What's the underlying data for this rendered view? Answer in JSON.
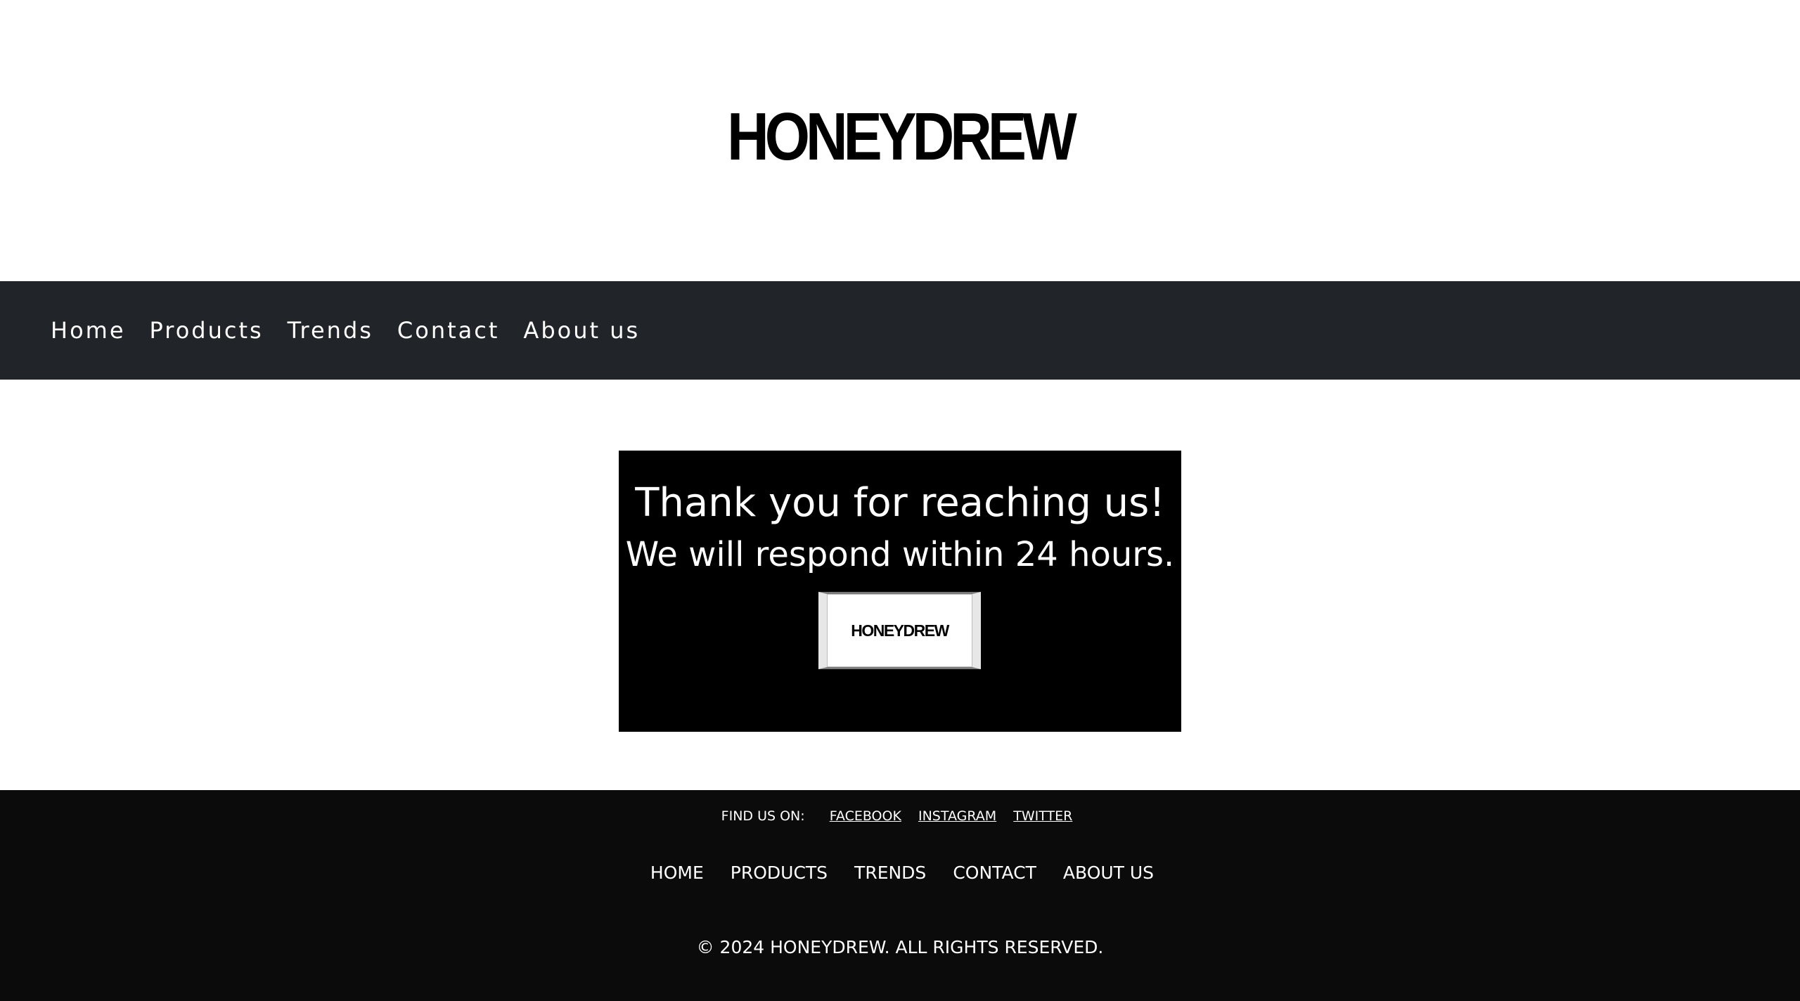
{
  "brand": {
    "logo_text": "HONEYDREW"
  },
  "topnav": {
    "items": [
      {
        "label": "Home"
      },
      {
        "label": "Products"
      },
      {
        "label": "Trends"
      },
      {
        "label": "Contact"
      },
      {
        "label": "About us"
      }
    ]
  },
  "thankyou": {
    "title": "Thank you for reaching us!",
    "subtitle": "We will respond within 24 hours.",
    "button_logo_text": "HONEYDREW"
  },
  "footer": {
    "find_us_label": "FIND US ON:",
    "social_links": [
      {
        "label": "FACEBOOK"
      },
      {
        "label": "INSTAGRAM"
      },
      {
        "label": "TWITTER"
      }
    ],
    "nav_items": [
      {
        "label": "HOME"
      },
      {
        "label": "PRODUCTS"
      },
      {
        "label": "TRENDS"
      },
      {
        "label": "CONTACT"
      },
      {
        "label": "ABOUT US"
      }
    ],
    "copyright": "© 2024 HONEYDREW. ALL RIGHTS RESERVED."
  },
  "colors": {
    "nav_background": "#212529",
    "footer_background": "#0b0b0b",
    "card_background": "#000000",
    "text_light": "#ffffff"
  }
}
